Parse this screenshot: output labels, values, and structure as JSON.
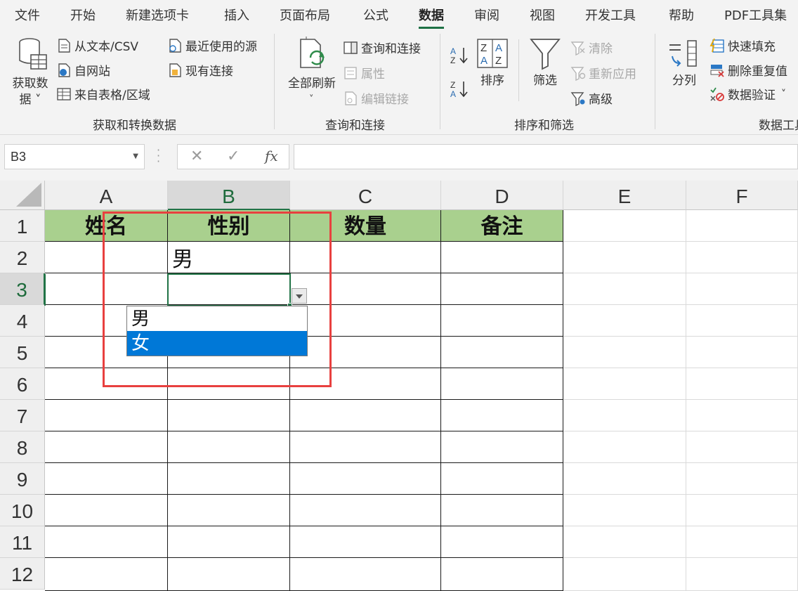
{
  "menu": {
    "tabs": [
      "文件",
      "开始",
      "新建选项卡",
      "插入",
      "页面布局",
      "公式",
      "数据",
      "审阅",
      "视图",
      "开发工具",
      "帮助",
      "PDF工具集"
    ],
    "active": "数据"
  },
  "ribbon": {
    "get_data": {
      "label_line1": "获取数",
      "label_line2": "据 ˅"
    },
    "from_text_csv": "从文本/CSV",
    "from_web": "自网站",
    "from_table": "来自表格/区域",
    "recent_sources": "最近使用的源",
    "existing_connections": "现有连接",
    "group_get_transform": "获取和转换数据",
    "refresh_all": "全部刷新",
    "queries_connections": "查询和连接",
    "properties": "属性",
    "edit_links": "编辑链接",
    "group_queries": "查询和连接",
    "sort": "排序",
    "filter": "筛选",
    "clear": "清除",
    "reapply": "重新应用",
    "advanced": "高级",
    "group_sort_filter": "排序和筛选",
    "text_to_columns": "分列",
    "flash_fill": "快速填充",
    "remove_duplicates": "删除重复值",
    "data_validation": "数据验证",
    "group_data_tools": "数据工具"
  },
  "formula_bar": {
    "name_box": "B3",
    "formula": "",
    "fx": "fx"
  },
  "sheet": {
    "columns": [
      "A",
      "B",
      "C",
      "D",
      "E",
      "F"
    ],
    "rows": [
      "1",
      "2",
      "3",
      "4",
      "5",
      "6",
      "7",
      "8",
      "9",
      "10",
      "11",
      "12"
    ],
    "header_row": [
      "姓名",
      "性别",
      "数量",
      "备注"
    ],
    "b2": "男",
    "selected_cell": "B3"
  },
  "dropdown": {
    "options": [
      "男",
      "女"
    ],
    "highlighted": "女"
  },
  "colors": {
    "header_fill": "#a9d08e",
    "accent": "#217346",
    "highlight": "#0078d7",
    "annotation": "#e8403f"
  }
}
